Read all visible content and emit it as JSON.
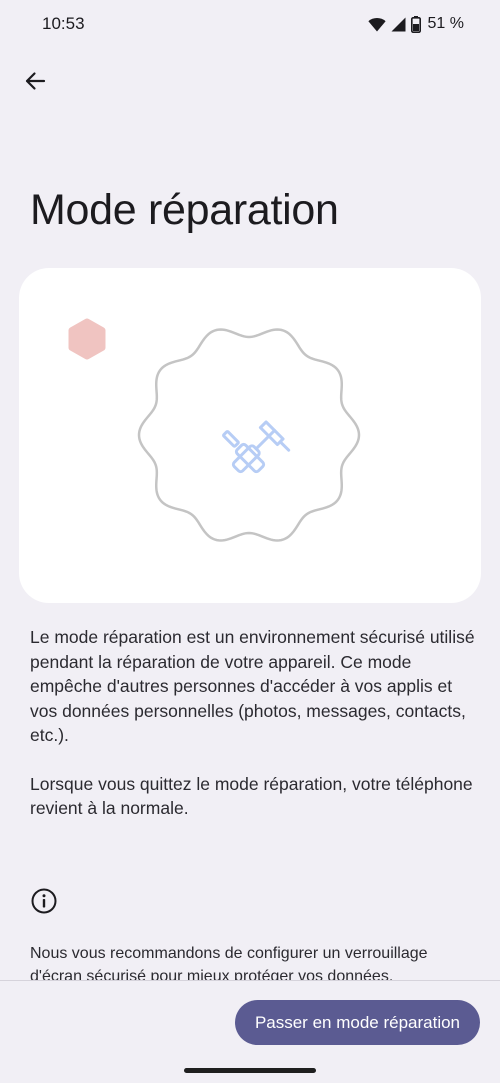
{
  "status_bar": {
    "time": "10:53",
    "battery": "51 %",
    "icons": [
      "wifi-icon",
      "cell-signal-icon",
      "battery-icon"
    ]
  },
  "header": {
    "back_icon": "arrow-back-icon",
    "title": "Mode réparation"
  },
  "illustration": {
    "icon": "repair-tools-icon",
    "colors": {
      "card": "#ffffff",
      "hexagon": "#f0c4c1",
      "outline": "#c4c4c4",
      "tools": "#b7cdf5"
    }
  },
  "content": {
    "paragraph_1": "Le mode réparation est un environnement sécurisé utilisé pendant la réparation de votre appareil. Ce mode empêche d'autres personnes d'accéder à vos applis et vos données personnelles (photos, messages, contacts, etc.).",
    "paragraph_2": "Lorsque vous quittez le mode réparation, votre téléphone revient à la normale.",
    "info_icon": "info-icon",
    "recommendation": "Nous vous recommandons de configurer un verrouillage d'écran sécurisé pour mieux protéger vos données."
  },
  "footer": {
    "primary_button_label": "Passer en mode réparation",
    "accent_color": "#5b5b92"
  }
}
